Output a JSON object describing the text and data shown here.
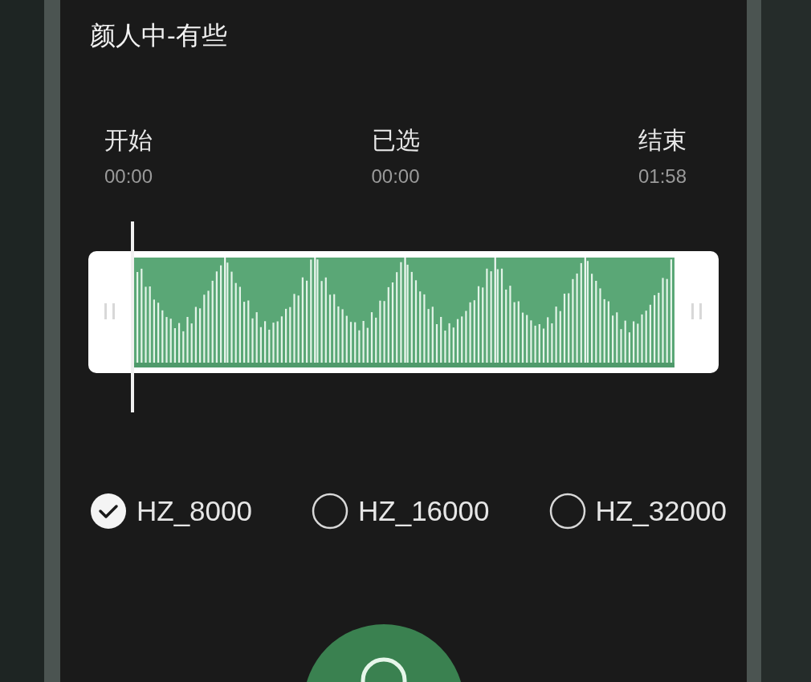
{
  "title": "颜人中-有些",
  "times": [
    {
      "label": "开始",
      "value": "00:00"
    },
    {
      "label": "已选",
      "value": "00:00"
    },
    {
      "label": "结束",
      "value": "01:58"
    }
  ],
  "sample_rates": [
    {
      "label": "HZ_8000",
      "selected": true
    },
    {
      "label": "HZ_16000",
      "selected": false
    },
    {
      "label": "HZ_32000",
      "selected": false
    }
  ]
}
